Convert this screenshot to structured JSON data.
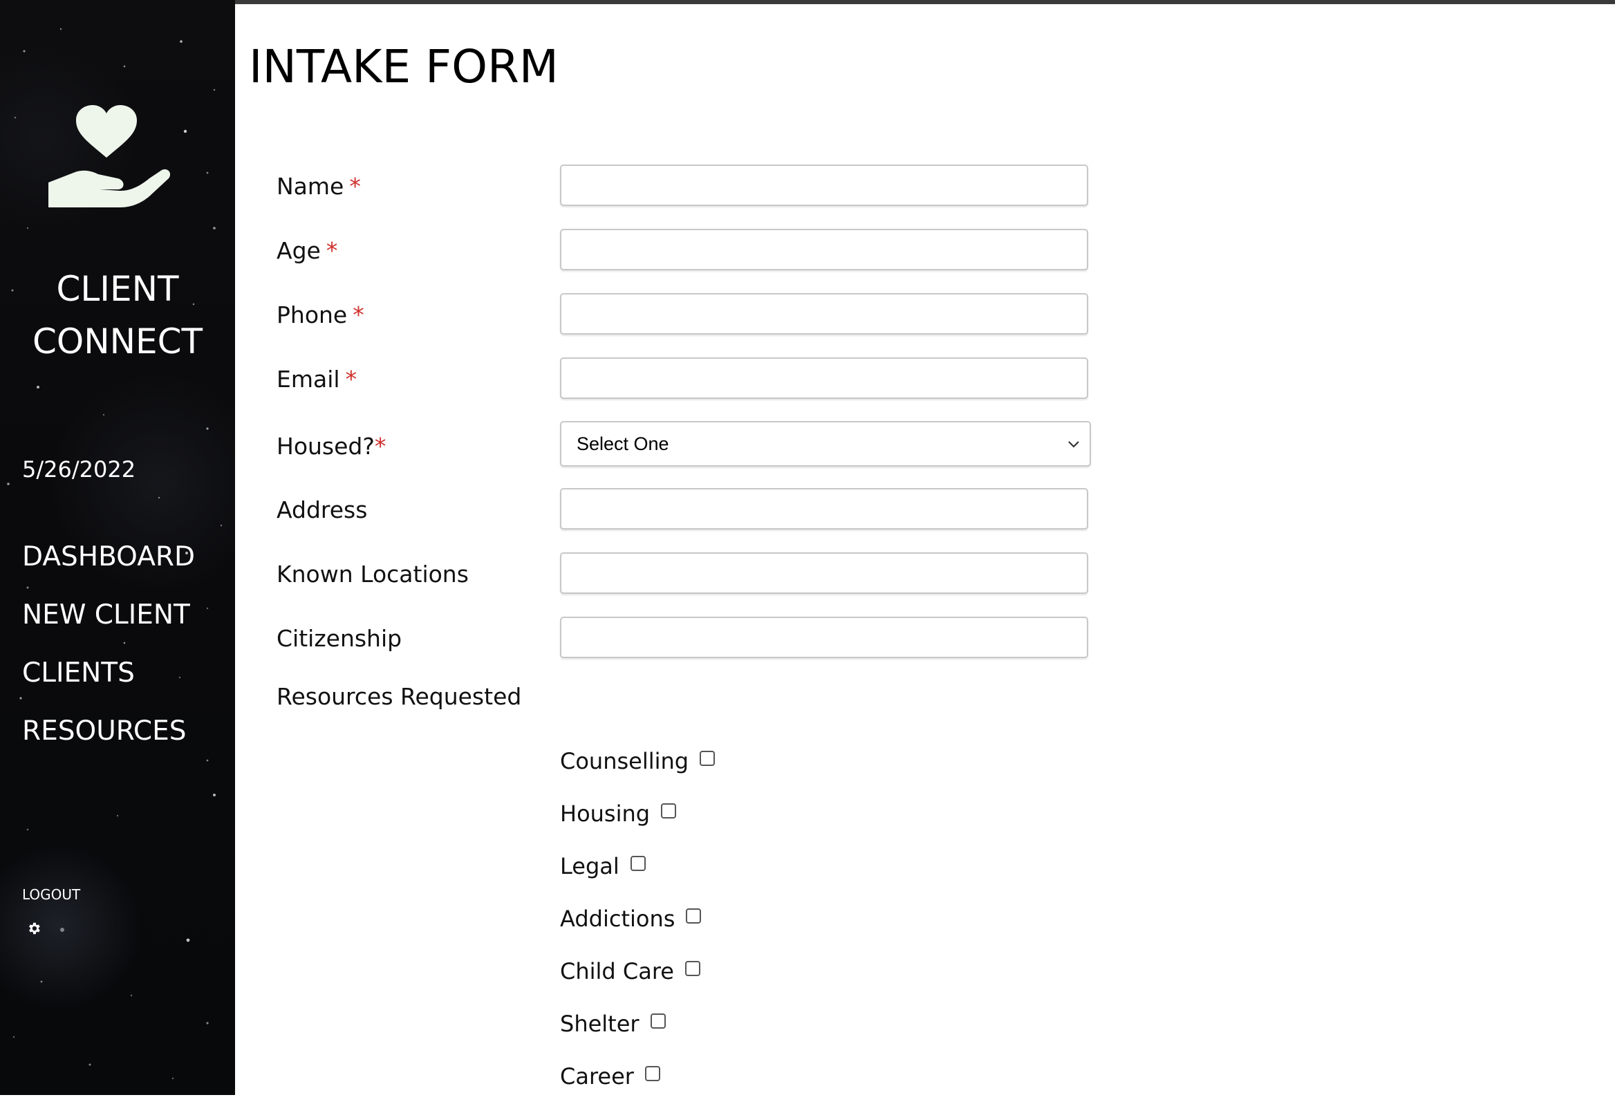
{
  "sidebar": {
    "brand_line1": "CLIENT",
    "brand_line2": "CONNECT",
    "date": "5/26/2022",
    "nav": [
      "DASHBOARD",
      "NEW CLIENT",
      "CLIENTS",
      "RESOURCES"
    ],
    "logout": "LOGOUT",
    "logo_icon": "heart-in-hand-icon",
    "settings_icon": "gear-icon"
  },
  "page": {
    "title": "INTAKE FORM"
  },
  "form": {
    "required_marker": "*",
    "fields": [
      {
        "label": "Name",
        "required": true,
        "value": ""
      },
      {
        "label": "Age",
        "required": true,
        "value": ""
      },
      {
        "label": "Phone",
        "required": true,
        "value": ""
      },
      {
        "label": "Email",
        "required": true,
        "value": ""
      },
      {
        "label": "Housed?",
        "required": true,
        "type": "select",
        "value": "Select One"
      },
      {
        "label": "Address",
        "required": false,
        "value": ""
      },
      {
        "label": "Known Locations",
        "required": false,
        "value": ""
      },
      {
        "label": "Citizenship",
        "required": false,
        "value": ""
      }
    ],
    "resources_label": "Resources Requested",
    "resources": [
      {
        "label": "Counselling",
        "checked": false
      },
      {
        "label": "Housing",
        "checked": false
      },
      {
        "label": "Legal",
        "checked": false
      },
      {
        "label": "Addictions",
        "checked": false
      },
      {
        "label": "Child Care",
        "checked": false
      },
      {
        "label": "Shelter",
        "checked": false
      },
      {
        "label": "Career",
        "checked": false
      }
    ]
  },
  "colors": {
    "sidebar_bg": "#0b0b0d",
    "accent_required": "#d0312d",
    "logo_fill": "#eef6ec"
  }
}
